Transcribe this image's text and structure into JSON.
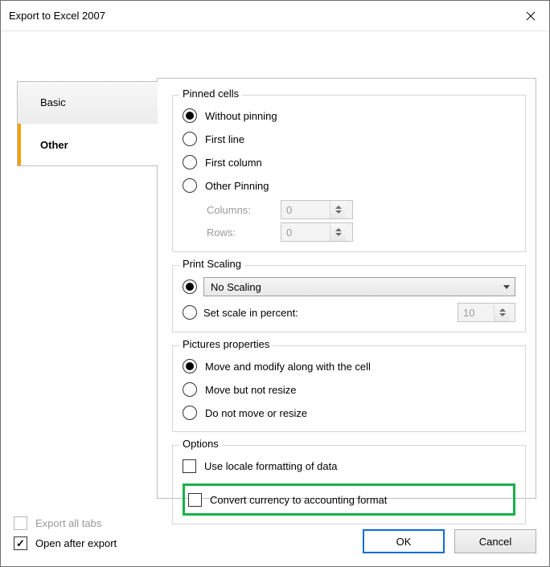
{
  "title": "Export to Excel 2007",
  "tabs": {
    "basic": "Basic",
    "other": "Other",
    "active": "other"
  },
  "groups": {
    "pinned": {
      "title": "Pinned cells",
      "options": {
        "without": "Without pinning",
        "first_line": "First line",
        "first_column": "First column",
        "other": "Other Pinning"
      },
      "selected": "without",
      "columns_label": "Columns:",
      "columns_value": "0",
      "rows_label": "Rows:",
      "rows_value": "0"
    },
    "scaling": {
      "title": "Print Scaling",
      "no_scaling": "No Scaling",
      "set_scale": "Set scale in percent:",
      "selected": "no_scaling",
      "percent_value": "10"
    },
    "pictures": {
      "title": "Pictures properties",
      "move_modify": "Move and modify along with the cell",
      "move_not_resize": "Move but not resize",
      "no_move": "Do not move or resize",
      "selected": "move_modify"
    },
    "options": {
      "title": "Options",
      "use_locale": "Use locale formatting of data",
      "convert_currency": "Convert currency to accounting format"
    }
  },
  "bottom": {
    "export_all_tabs": "Export all tabs",
    "open_after_export": "Open after export",
    "ok": "OK",
    "cancel": "Cancel"
  }
}
